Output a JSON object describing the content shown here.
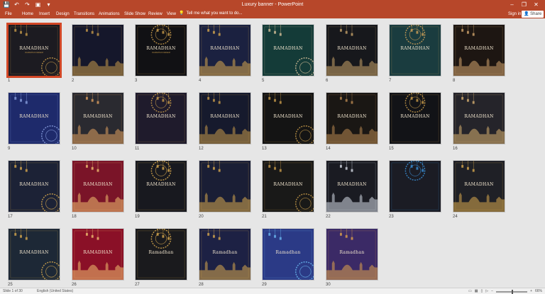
{
  "window": {
    "title": "Luxury banner - PowerPoint",
    "minimize": "–",
    "restore": "❐",
    "close": "✕"
  },
  "qat": [
    "💾",
    "↶",
    "↷",
    "▣",
    "▾"
  ],
  "ribbon": {
    "tabs": [
      "File",
      "Home",
      "Insert",
      "Design",
      "Transitions",
      "Animations",
      "Slide Show",
      "Review",
      "View"
    ],
    "tell_me": "Tell me what you want to do...",
    "sign_in": "Sign in",
    "share": "Share"
  },
  "slides": [
    {
      "num": "1",
      "title": "RAMADHAN",
      "sub": "RAMADHAN KAREEM",
      "bg": "#1c1b21",
      "accent": "#c89b4a",
      "selected": true
    },
    {
      "num": "2",
      "title": "",
      "sub": "",
      "bg": "#15172b",
      "accent": "#c89b4a"
    },
    {
      "num": "3",
      "title": "RAMADHAN",
      "sub": "RAMADHAN KAREEM",
      "bg": "#111114",
      "accent": "#c89b4a"
    },
    {
      "num": "4",
      "title": "RAMADHAN",
      "sub": "",
      "bg": "#1b2140",
      "accent": "#d8a94e"
    },
    {
      "num": "5",
      "title": "RAMADHAN",
      "sub": "",
      "bg": "#143b38",
      "accent": "#d8c29a"
    },
    {
      "num": "6",
      "title": "RAMADHAN",
      "sub": "",
      "bg": "#17181c",
      "accent": "#c8a46a"
    },
    {
      "num": "7",
      "title": "RAMADHAN",
      "sub": "",
      "bg": "#1a3c3f",
      "accent": "#d0a058"
    },
    {
      "num": "8",
      "title": "RAMADHAN",
      "sub": "",
      "bg": "#1d1612",
      "accent": "#d3a66d"
    },
    {
      "num": "9",
      "title": "RAMADHAN",
      "sub": "",
      "bg": "#1e2a6b",
      "accent": "#8aa0e0"
    },
    {
      "num": "10",
      "title": "RAMADHAN",
      "sub": "",
      "bg": "#2a2a30",
      "accent": "#e0a060"
    },
    {
      "num": "11",
      "title": "RAMADHAN",
      "sub": "",
      "bg": "#1f1b2c",
      "accent": "#c89b4a"
    },
    {
      "num": "12",
      "title": "RAMADHAN",
      "sub": "",
      "bg": "#161a2d",
      "accent": "#c89b4a"
    },
    {
      "num": "13",
      "title": "RAMADHAN",
      "sub": "",
      "bg": "#141414",
      "accent": "#c89b4a"
    },
    {
      "num": "14",
      "title": "RAMADHAN",
      "sub": "",
      "bg": "#1a1714",
      "accent": "#b98850"
    },
    {
      "num": "15",
      "title": "RAMADHAN",
      "sub": "",
      "bg": "#121317",
      "accent": "#c89b4a"
    },
    {
      "num": "16",
      "title": "RAMADHAN",
      "sub": "",
      "bg": "#25242a",
      "accent": "#d8b070"
    },
    {
      "num": "17",
      "title": "RAMADHAN",
      "sub": "",
      "bg": "#1c2236",
      "accent": "#d8a94e"
    },
    {
      "num": "18",
      "title": "RAMADHAN",
      "sub": "",
      "bg": "#7a1428",
      "accent": "#f0c070"
    },
    {
      "num": "19",
      "title": "RAMADHAN",
      "sub": "",
      "bg": "#18191f",
      "accent": "#d8a94e"
    },
    {
      "num": "20",
      "title": "",
      "sub": "",
      "bg": "#1a1e35",
      "accent": "#d8a94e"
    },
    {
      "num": "21",
      "title": "RAMADHAN",
      "sub": "",
      "bg": "#191918",
      "accent": "#c89b4a"
    },
    {
      "num": "22",
      "title": "RAMADHAN",
      "sub": "",
      "bg": "#1a1b22",
      "accent": "#d6dbe6"
    },
    {
      "num": "23",
      "title": "",
      "sub": "",
      "bg": "#1b1c24",
      "accent": "#3a8fd6"
    },
    {
      "num": "24",
      "title": "RAMADHAN",
      "sub": "",
      "bg": "#1f2026",
      "accent": "#d8a94e"
    },
    {
      "num": "25",
      "title": "RAMADHAN",
      "sub": "",
      "bg": "#1d2836",
      "accent": "#d8a94e"
    },
    {
      "num": "26",
      "title": "RAMADHAN",
      "sub": "",
      "bg": "#8a1027",
      "accent": "#f0c070"
    },
    {
      "num": "27",
      "title": "Ramadhan",
      "sub": "",
      "bg": "#1a1a1d",
      "accent": "#d8a94e"
    },
    {
      "num": "28",
      "title": "Ramadhan",
      "sub": "",
      "bg": "#1d2144",
      "accent": "#d8a94e"
    },
    {
      "num": "29",
      "title": "Ramadhan",
      "sub": "",
      "bg": "#2b3a86",
      "accent": "#6ab8f0"
    },
    {
      "num": "30",
      "title": "Ramadhan",
      "sub": "",
      "bg": "#3b2a66",
      "accent": "#e0a24a"
    }
  ],
  "status": {
    "slide_info": "Slide 1 of 30",
    "language": "English (United States)",
    "zoom": "66%"
  }
}
